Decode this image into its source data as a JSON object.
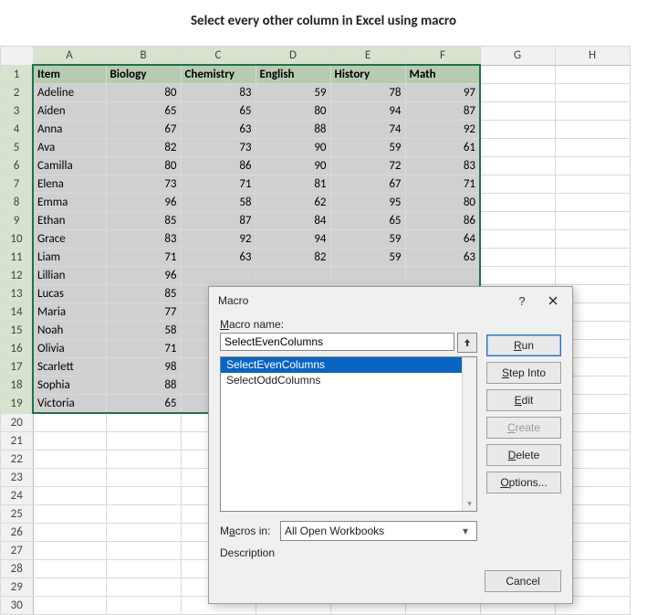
{
  "title": "Select every other column in Excel using macro",
  "columns": [
    "A",
    "B",
    "C",
    "D",
    "E",
    "F",
    "G",
    "H"
  ],
  "selected_col_letters": [
    "A",
    "B",
    "C",
    "D",
    "E",
    "F"
  ],
  "row_count": 30,
  "data_rows": 19,
  "headers": [
    "Item",
    "Biology",
    "Chemistry",
    "English",
    "History",
    "Math"
  ],
  "rows": [
    {
      "name": "Adeline",
      "scores": [
        80,
        83,
        59,
        78,
        97
      ]
    },
    {
      "name": "Aiden",
      "scores": [
        65,
        65,
        80,
        94,
        87
      ]
    },
    {
      "name": "Anna",
      "scores": [
        67,
        63,
        88,
        74,
        92
      ]
    },
    {
      "name": "Ava",
      "scores": [
        82,
        73,
        90,
        59,
        61
      ]
    },
    {
      "name": "Camilla",
      "scores": [
        80,
        86,
        90,
        72,
        83
      ]
    },
    {
      "name": "Elena",
      "scores": [
        73,
        71,
        81,
        67,
        71
      ]
    },
    {
      "name": "Emma",
      "scores": [
        96,
        58,
        62,
        95,
        80
      ]
    },
    {
      "name": "Ethan",
      "scores": [
        85,
        87,
        84,
        65,
        86
      ]
    },
    {
      "name": "Grace",
      "scores": [
        83,
        92,
        94,
        59,
        64
      ]
    },
    {
      "name": "Liam",
      "scores": [
        71,
        63,
        82,
        59,
        63
      ]
    },
    {
      "name": "Lillian",
      "scores": [
        96,
        null,
        null,
        null,
        null
      ]
    },
    {
      "name": "Lucas",
      "scores": [
        85,
        null,
        null,
        null,
        null
      ]
    },
    {
      "name": "Maria",
      "scores": [
        77,
        null,
        null,
        null,
        null
      ]
    },
    {
      "name": "Noah",
      "scores": [
        58,
        null,
        null,
        null,
        null
      ]
    },
    {
      "name": "Olivia",
      "scores": [
        71,
        null,
        null,
        null,
        null
      ]
    },
    {
      "name": "Scarlett",
      "scores": [
        98,
        null,
        null,
        null,
        null
      ]
    },
    {
      "name": "Sophia",
      "scores": [
        88,
        null,
        null,
        null,
        null
      ]
    },
    {
      "name": "Victoria",
      "scores": [
        65,
        null,
        null,
        null,
        null
      ]
    }
  ],
  "dialog": {
    "title": "Macro",
    "help": "?",
    "macro_name_label_pre": "M",
    "macro_name_label_post": "acro name:",
    "macro_name_value": "SelectEvenColumns",
    "list": [
      "SelectEvenColumns",
      "SelectOddColumns"
    ],
    "selected_index": 0,
    "macros_in_pre": "M",
    "macros_in_u": "a",
    "macros_in_post": "cros in:",
    "macros_in_value": "All Open Workbooks",
    "description_label": "Description",
    "buttons": {
      "run_u": "R",
      "run_post": "un",
      "step_pre": "",
      "step_u": "S",
      "step_post": "tep Into",
      "edit_u": "E",
      "edit_post": "dit",
      "create_u": "C",
      "create_post": "reate",
      "delete_u": "D",
      "delete_post": "elete",
      "options_u": "O",
      "options_post": "ptions...",
      "cancel": "Cancel"
    }
  }
}
